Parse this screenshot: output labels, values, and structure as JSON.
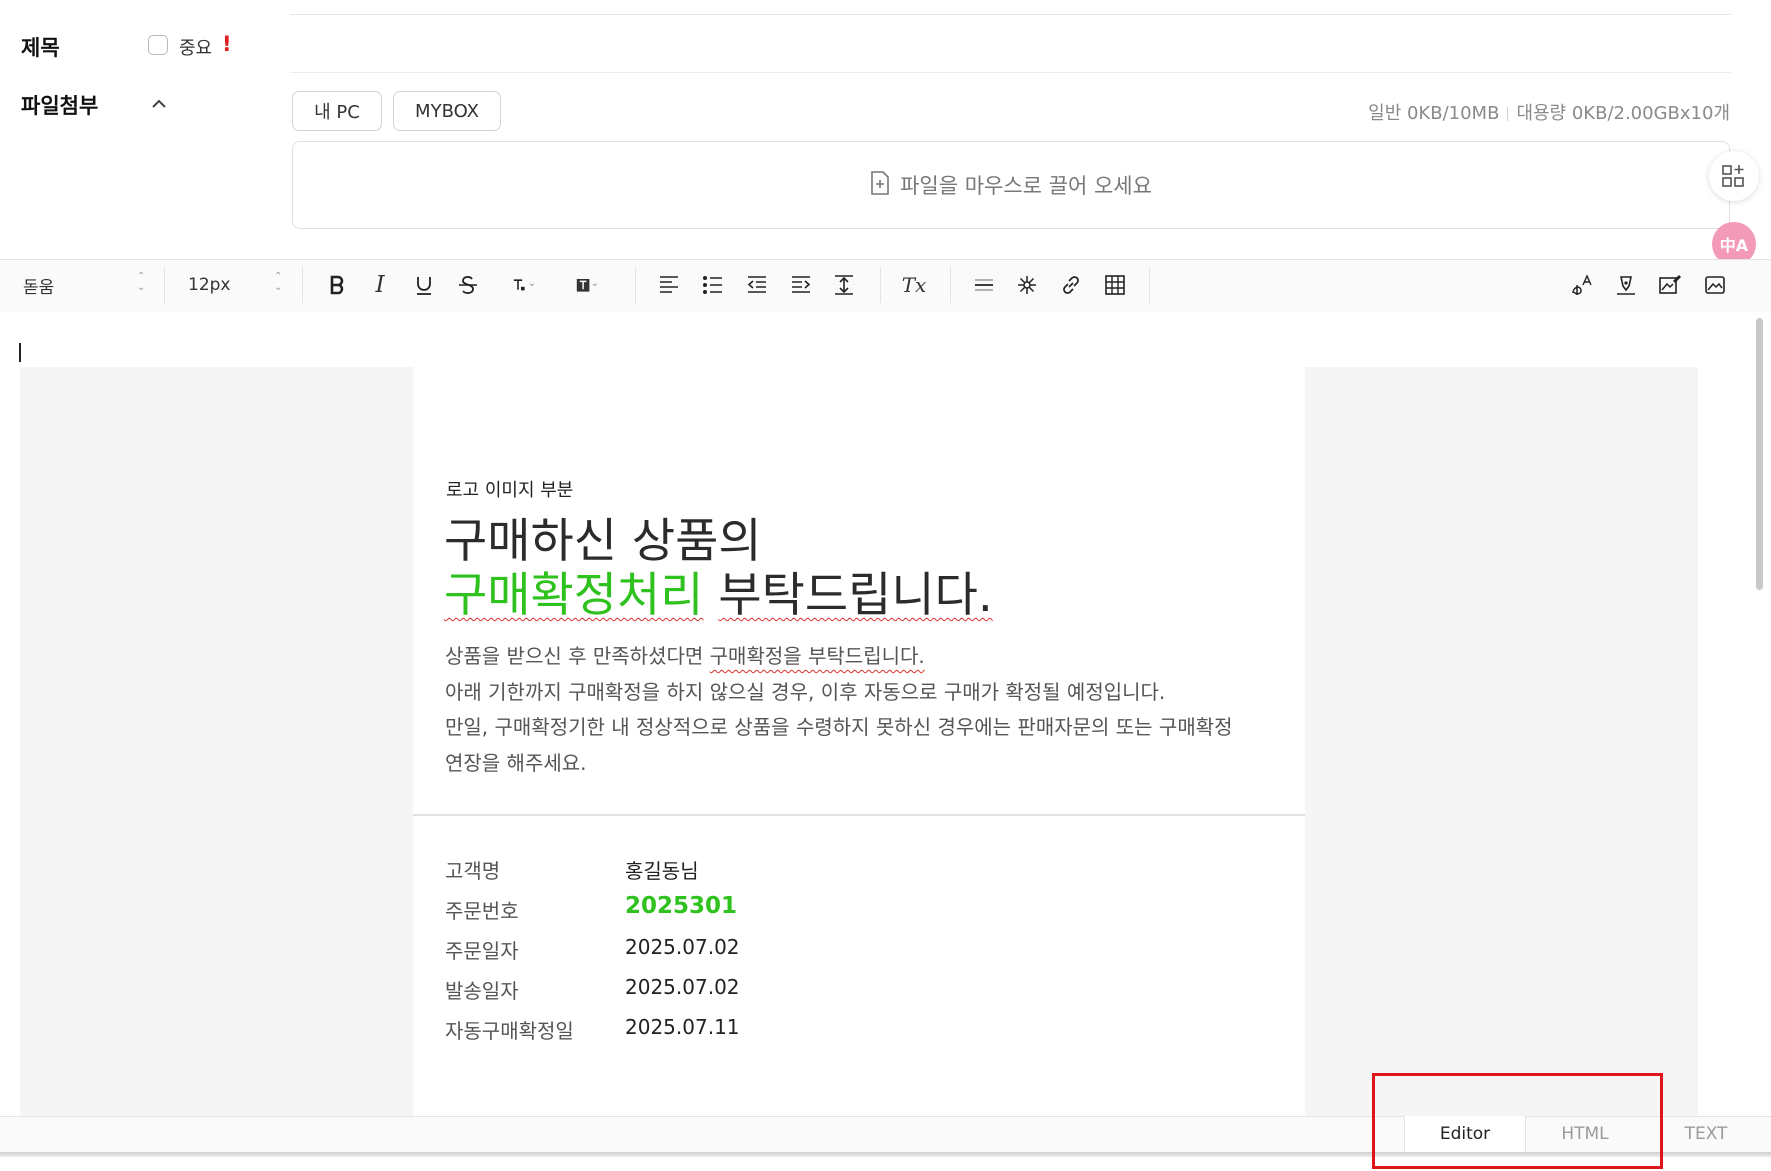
{
  "form": {
    "title_label": "제목",
    "important_label": "중요",
    "important_mark": "!",
    "attach_label": "파일첨부",
    "attach_toggle": "^",
    "btn_mypc": "내 PC",
    "btn_mybox": "MYBOX",
    "quota_normal": "일반 0KB/10MB",
    "quota_large": "대용량 0KB/2.00GBx10개",
    "dropzone_text": "파일을 마우스로 끌어 오세요"
  },
  "side_widgets": {
    "translate_text": "中A"
  },
  "toolbar": {
    "font_family": "돋움",
    "font_size": "12px",
    "italic": "I",
    "text_style": "T",
    "clear_format": "Tx"
  },
  "mail": {
    "logo_placeholder": "로고 이미지 부분",
    "headline_line1": "구매하신 상품의",
    "headline_green": "구매확정처리",
    "headline_rest": "부탁드립니다.",
    "para_line1_before": "상품을 받으신 후 만족하셨다면 ",
    "para_line1_underlined": "구매확정을 부탁드립니다.",
    "para_line2": "아래 기한까지 구매확정을 하지 않으실 경우, 이후 자동으로 구매가 확정될 예정입니다.",
    "para_line3": "만일, 구매확정기한 내 정상적으로 상품을 수령하지 못하신 경우에는 판매자문의 또는 구매확정",
    "para_line4": "연장을 해주세요.",
    "rows": [
      {
        "label": "고객명",
        "value": "홍길동님"
      },
      {
        "label": "주문번호",
        "value": "2025301"
      },
      {
        "label": "주문일자",
        "value": "2025.07.02"
      },
      {
        "label": "발송일자",
        "value": "2025.07.02"
      },
      {
        "label": "자동구매확정일",
        "value": "2025.07.11"
      }
    ]
  },
  "modes": {
    "editor": "Editor",
    "html": "HTML",
    "text": "TEXT",
    "active": "Editor"
  },
  "colors": {
    "accent_green": "#2fc21f",
    "highlight_box": "#e0141b"
  }
}
